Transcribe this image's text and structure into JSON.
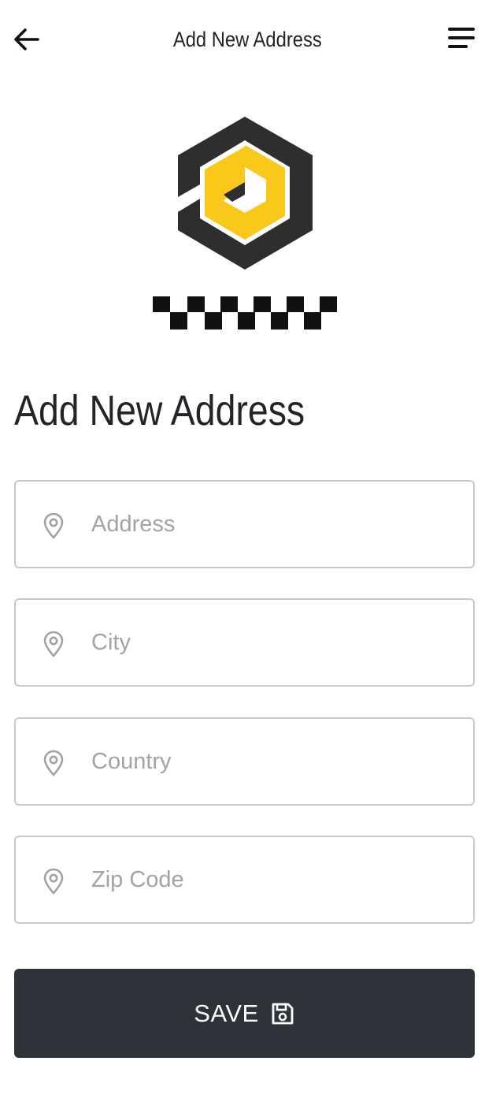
{
  "header": {
    "title": "Add New Address"
  },
  "page": {
    "heading": "Add New Address"
  },
  "form": {
    "fields": [
      {
        "placeholder": "Address",
        "value": ""
      },
      {
        "placeholder": "City",
        "value": ""
      },
      {
        "placeholder": "Country",
        "value": ""
      },
      {
        "placeholder": "Zip Code",
        "value": ""
      }
    ],
    "save_label": "SAVE"
  },
  "icons": {
    "back": "arrow-left-icon",
    "menu": "menu-lines-icon",
    "field": "location-pin-icon",
    "save": "floppy-disk-icon"
  },
  "colors": {
    "logo_yellow": "#F9C81A",
    "logo_dark": "#2E2E2E",
    "button_bg": "#2F3238",
    "field_border": "#C9C9C9",
    "placeholder": "#A3A3A3"
  }
}
